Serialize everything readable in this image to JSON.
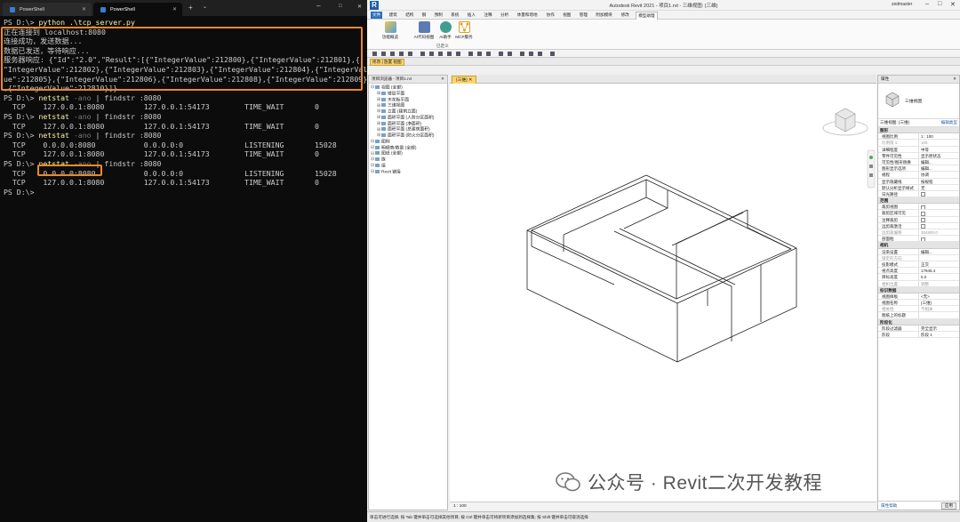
{
  "terminal": {
    "tabs": [
      {
        "label": "PowerShell"
      },
      {
        "label": "PowerShell"
      }
    ],
    "add_tab": "+",
    "dropdown": "⌄",
    "window_controls": {
      "minimize": "–",
      "maximize": "□",
      "close": "✕"
    },
    "lines": [
      {
        "prompt": "PS D:\\> ",
        "cmd": "python .\\tcp_server.py"
      },
      {
        "text": "正在连接到 localhost:8080"
      },
      {
        "text": "连接成功，发送数据..."
      },
      {
        "text": "数据已发送，等待响应..."
      },
      {
        "text": "服务器响应: {\"Id\":\"2.0\",\"Result\":[{\"IntegerValue\":212800},{\"IntegerValue\":212801},{"
      },
      {
        "text": "\"IntegerValue\":212802},{\"IntegerValue\":212803},{\"IntegerValue\":212804},{\"IntegerVal"
      },
      {
        "text": "ue\":212805},{\"IntegerValue\":212806},{\"IntegerValue\":212808},{\"IntegerValue\":212809}"
      },
      {
        "text": ",{\"IntegerValue\":212810}]}"
      },
      {
        "prompt": "PS D:\\> ",
        "cmd": "netstat",
        "flag": " -ano ",
        "pipe": "| findstr :8080"
      },
      {
        "text": "  TCP    127.0.0.1:8080         127.0.0.1:54173        TIME_WAIT       0"
      },
      {
        "prompt": "PS D:\\> ",
        "cmd": "netstat",
        "flag": " -ano ",
        "pipe": "| findstr :8080"
      },
      {
        "text": "  TCP    127.0.0.1:8080         127.0.0.1:54173        TIME_WAIT       0"
      },
      {
        "prompt": "PS D:\\> ",
        "cmd": "netstat",
        "flag": " -ano ",
        "pipe": "| findstr :8080"
      },
      {
        "text": "  TCP    0.0.0.0:8080           0.0.0.0:0              LISTENING       15028"
      },
      {
        "text": "  TCP    127.0.0.1:8080         127.0.0.1:54173        TIME_WAIT       0"
      },
      {
        "prompt": "PS D:\\> ",
        "cmd": "netstat",
        "flag": " -ano ",
        "pipe": "| findstr :8080"
      },
      {
        "text": "  TCP    0.0.0.0:8080           0.0.0.0:0              LISTENING       15028"
      },
      {
        "text": "  TCP    127.0.0.1:8080         127.0.0.1:54173        TIME_WAIT       0"
      },
      {
        "prompt": "PS D:\\> ",
        "cmd": "",
        "flag": "",
        "pipe": ""
      }
    ],
    "highlight_color": "#e8892b"
  },
  "revit": {
    "logo": "R",
    "title": "Autodesk Revit 2021 - 项目1.rvt - 三维视图: {三维}",
    "user": "zedmaster",
    "menus": [
      "文件",
      "建筑",
      "结构",
      "钢",
      "预制",
      "系统",
      "插入",
      "注释",
      "分析",
      "体量和场地",
      "协作",
      "视图",
      "管理",
      "附加模块",
      "修改"
    ],
    "selected_menu": "模型助理",
    "ribbon_buttons": [
      {
        "label": "功能概览"
      },
      {
        "label": "AI代码视图"
      },
      {
        "label": "AI助手"
      },
      {
        "label": "MCP服务"
      }
    ],
    "ribbon_group": "已定义",
    "option_bar": "修改 | 放置 视图",
    "browser": {
      "title": "项目浏览器 - 项目1.rvt",
      "items": [
        {
          "label": "视图 (全部)",
          "level": 0
        },
        {
          "label": "楼层平面",
          "level": 1
        },
        {
          "label": "天花板平面",
          "level": 1
        },
        {
          "label": "三维视图",
          "level": 1
        },
        {
          "label": "立面 (建筑立面)",
          "level": 1
        },
        {
          "label": "面积平面 (人防分区面积)",
          "level": 1
        },
        {
          "label": "面积平面 (净面积)",
          "level": 1
        },
        {
          "label": "面积平面 (总建筑面积)",
          "level": 1
        },
        {
          "label": "面积平面 (防火分区面积)",
          "level": 1
        },
        {
          "label": "图例",
          "level": 0
        },
        {
          "label": "明细表/数量 (全部)",
          "level": 0
        },
        {
          "label": "图纸 (全部)",
          "level": 0
        },
        {
          "label": "族",
          "level": 0
        },
        {
          "label": "组",
          "level": 0
        },
        {
          "label": "Revit 链接",
          "level": 0
        }
      ]
    },
    "view_tab": "{三维}",
    "view_scale": "1 : 100",
    "properties": {
      "title": "属性",
      "type_name": "三维视图",
      "selector": "三维视图: {三维}",
      "edit_type": "编辑类型",
      "sections": [
        {
          "name": "图形",
          "rows": [
            {
              "k": "视图比例",
              "v": "1 : 100"
            },
            {
              "k": "比例值 1:",
              "v": "100",
              "dim": true
            },
            {
              "k": "详细程度",
              "v": "中等"
            },
            {
              "k": "零件可见性",
              "v": "显示原状态"
            },
            {
              "k": "可见性/图形替换",
              "v": "编辑..."
            },
            {
              "k": "图形显示选项",
              "v": "编辑..."
            },
            {
              "k": "规程",
              "v": "协调"
            },
            {
              "k": "显示隐藏线",
              "v": "按规程"
            },
            {
              "k": "默认分析显示样式",
              "v": "无"
            },
            {
              "k": "日光路径",
              "v": "",
              "check": true
            }
          ]
        },
        {
          "name": "范围",
          "rows": [
            {
              "k": "裁剪视图",
              "v": "",
              "check": true
            },
            {
              "k": "裁剪区域可见",
              "v": "",
              "check": true
            },
            {
              "k": "注释裁剪",
              "v": "",
              "check": true
            },
            {
              "k": "远剪裁激活",
              "v": "",
              "check": true
            },
            {
              "k": "远剪裁偏移",
              "v": "304800.0",
              "dim": true
            },
            {
              "k": "剖面框",
              "v": "",
              "check": true
            }
          ]
        },
        {
          "name": "相机",
          "rows": [
            {
              "k": "渲染设置",
              "v": "编辑..."
            },
            {
              "k": "锁定的方向",
              "v": "",
              "dim": true
            },
            {
              "k": "投影模式",
              "v": "正交"
            },
            {
              "k": "视点高度",
              "v": "17945.4"
            },
            {
              "k": "目标高度",
              "v": "5.0"
            },
            {
              "k": "相机位置",
              "v": "调整",
              "dim": true
            }
          ]
        },
        {
          "name": "标识数据",
          "rows": [
            {
              "k": "视图样板",
              "v": "<无>"
            },
            {
              "k": "视图名称",
              "v": "{三维}"
            },
            {
              "k": "相关性",
              "v": "不相关",
              "dim": true
            },
            {
              "k": "图纸上的标题",
              "v": ""
            }
          ]
        },
        {
          "name": "阶段化",
          "rows": [
            {
              "k": "阶段过滤器",
              "v": "完全显示"
            },
            {
              "k": "阶段",
              "v": "阶段 1"
            }
          ]
        }
      ],
      "help": "属性帮助",
      "apply": "应用"
    },
    "status": "单击可进行选择; 按 Tab 键并单击可选择其他项目; 按 Ctrl 键并单击可将新项目添加到选择集; 按 Shift 键并单击可取消选择"
  },
  "watermark": {
    "text": "公众号 · Revit二次开发教程"
  }
}
